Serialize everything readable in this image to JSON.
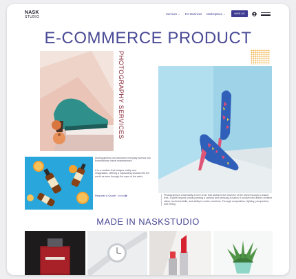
{
  "header": {
    "logo_line1": "NASK",
    "logo_line2": "STUDIO",
    "nav": [
      {
        "label": "Services ⌄"
      },
      {
        "label": "For Business"
      },
      {
        "label": "Marketplace ⌄"
      }
    ],
    "hire_label": "HIRE US"
  },
  "hero": {
    "title": "E-COMMERCE PRODUCT",
    "vertical_text": "PHOTOGRAPHY SERVICES"
  },
  "content": {
    "para1": "photographers can transform everyday scenes into extraordinary visual masterpieces.",
    "para2": "It is a medium that bridges reality and imagination, offering a captivating window into the world as seen through the eyes of the artist.",
    "para3": "Photography is undeniably a form of art that captures the essence of the world through a unique lens. It goes beyond simply pointing a camera and pressing a button; it involves the artist's creative vision, technical skills, and ability to evoke emotions. Through composition, lighting, perspective, and timing,",
    "link_label": "Request a Quote"
  },
  "gallery": {
    "title": "MADE IN NASKSTUDIO"
  },
  "colors": {
    "brand_purple": "#3e3b92",
    "title": "#4a4a96",
    "accent_red": "#8a2b3a",
    "dots": "#f2b552"
  },
  "icons": [
    "user-icon",
    "hamburger-menu-icon",
    "arrow-right-icon"
  ]
}
